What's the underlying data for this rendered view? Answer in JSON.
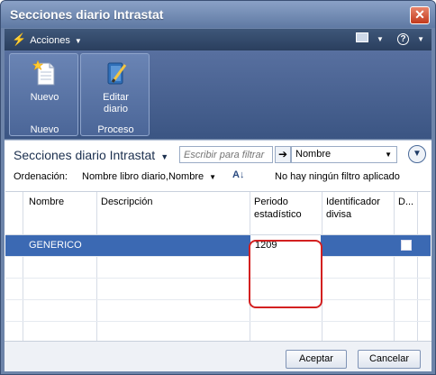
{
  "window": {
    "title": "Secciones diario Intrastat",
    "close_glyph": "✕"
  },
  "actionbar": {
    "acciones_label": "Acciones",
    "help_glyph": "?"
  },
  "ribbon": {
    "groups": [
      {
        "button_label_1": "Nuevo",
        "button_label_2": "",
        "group_label": "Nuevo",
        "icon": "new-document-icon"
      },
      {
        "button_label_1": "Editar",
        "button_label_2": "diario",
        "group_label": "Proceso",
        "icon": "edit-journal-icon"
      }
    ]
  },
  "list": {
    "title": "Secciones diario Intrastat",
    "filter_placeholder": "Escribir para filtrar",
    "filter_field": "Nombre",
    "sort_label": "Ordenación:",
    "sort_value": "Nombre libro diario,Nombre",
    "no_filter_text": "No hay ningún filtro aplicado",
    "columns": [
      {
        "label_1": "Nombre",
        "label_2": ""
      },
      {
        "label_1": "Descripción",
        "label_2": ""
      },
      {
        "label_1": "Periodo",
        "label_2": "estadístico"
      },
      {
        "label_1": "Identificador",
        "label_2": "divisa"
      },
      {
        "label_1": "D...",
        "label_2": ""
      }
    ],
    "rows": [
      {
        "nombre": "GENERICO",
        "descripcion": "",
        "periodo": "1209",
        "divisa": "",
        "checked": false
      }
    ]
  },
  "footer": {
    "accept_label": "Aceptar",
    "cancel_label": "Cancelar"
  },
  "colors": {
    "selected_row": "#3b69b3",
    "highlight": "#d32020",
    "actionbar": "#2a3f5e"
  }
}
